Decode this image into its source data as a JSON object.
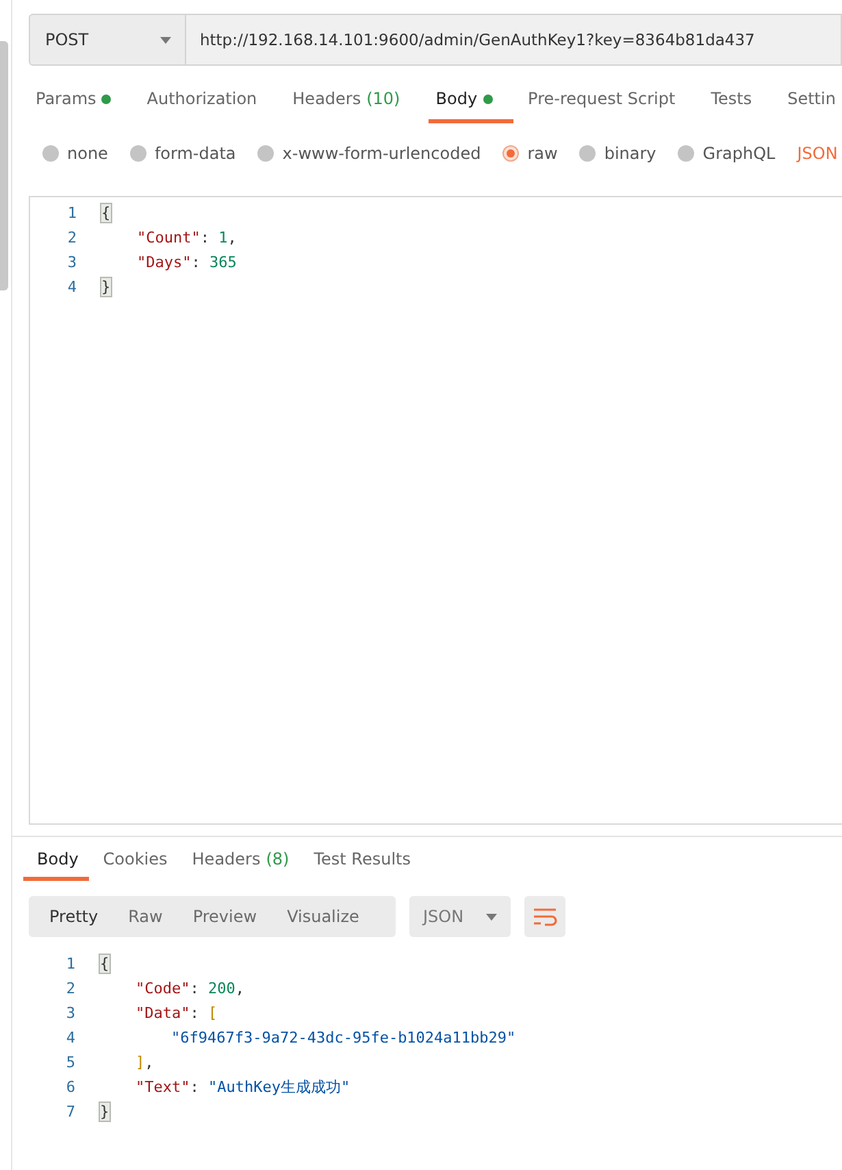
{
  "request": {
    "method": "POST",
    "url": "http://192.168.14.101:9600/admin/GenAuthKey1?key=8364b81da437"
  },
  "request_tabs": [
    {
      "label": "Params",
      "dot": true,
      "selected": false
    },
    {
      "label": "Authorization",
      "dot": false,
      "selected": false
    },
    {
      "label": "Headers",
      "count": "(10)",
      "dot": false,
      "selected": false
    },
    {
      "label": "Body",
      "dot": true,
      "selected": true
    },
    {
      "label": "Pre-request Script",
      "dot": false,
      "selected": false
    },
    {
      "label": "Tests",
      "dot": false,
      "selected": false
    },
    {
      "label": "Settin",
      "dot": false,
      "selected": false
    }
  ],
  "body_types": [
    {
      "label": "none",
      "selected": false
    },
    {
      "label": "form-data",
      "selected": false
    },
    {
      "label": "x-www-form-urlencoded",
      "selected": false
    },
    {
      "label": "raw",
      "selected": true
    },
    {
      "label": "binary",
      "selected": false
    },
    {
      "label": "GraphQL",
      "selected": false
    }
  ],
  "raw_format": "JSON",
  "request_body": [
    {
      "number": "1",
      "tokens": [
        {
          "kind": "brace",
          "text": "{"
        }
      ],
      "children": [
        {
          "number": "2",
          "tokens": [
            {
              "kind": "key",
              "text": "\"Count\""
            },
            {
              "kind": "punct",
              "text": ":"
            },
            {
              "kind": "number",
              "text": "1"
            },
            {
              "kind": "punct",
              "text": ","
            }
          ]
        },
        {
          "number": "3",
          "tokens": [
            {
              "kind": "key",
              "text": "\"Days\""
            },
            {
              "kind": "punct",
              "text": ":"
            },
            {
              "kind": "number",
              "text": "365"
            }
          ]
        }
      ]
    },
    {
      "number": "4",
      "tokens": [
        {
          "kind": "brace",
          "text": "}"
        }
      ]
    }
  ],
  "response_tabs": [
    {
      "label": "Body",
      "selected": true
    },
    {
      "label": "Cookies",
      "selected": false
    },
    {
      "label": "Headers",
      "count": "(8)",
      "selected": false
    },
    {
      "label": "Test Results",
      "selected": false
    }
  ],
  "view_modes": [
    {
      "label": "Pretty",
      "selected": true
    },
    {
      "label": "Raw",
      "selected": false
    },
    {
      "label": "Preview",
      "selected": false
    },
    {
      "label": "Visualize",
      "selected": false
    }
  ],
  "response_format": "JSON",
  "response_body": [
    {
      "number": "1",
      "tokens": [
        {
          "kind": "brace",
          "text": "{"
        }
      ],
      "children": [
        {
          "number": "2",
          "tokens": [
            {
              "kind": "key",
              "text": "\"Code\""
            },
            {
              "kind": "punct",
              "text": ":"
            },
            {
              "kind": "number",
              "text": "200"
            },
            {
              "kind": "punct",
              "text": ","
            }
          ]
        },
        {
          "number": "3",
          "tokens": [
            {
              "kind": "key",
              "text": "\"Data\""
            },
            {
              "kind": "punct",
              "text": ":"
            },
            {
              "kind": "bracket",
              "text": "["
            }
          ],
          "children": [
            {
              "number": "4",
              "tokens": [
                {
                  "kind": "string",
                  "text": "\"6f9467f3-9a72-43dc-95fe-b1024a11bb29\""
                }
              ]
            }
          ]
        },
        {
          "number": "5",
          "tokens": [
            {
              "kind": "bracket",
              "text": "]"
            },
            {
              "kind": "punct",
              "text": ","
            }
          ]
        },
        {
          "number": "6",
          "tokens": [
            {
              "kind": "key",
              "text": "\"Text\""
            },
            {
              "kind": "punct",
              "text": ":"
            },
            {
              "kind": "string",
              "text": "\"AuthKey生成成功\""
            }
          ]
        }
      ]
    },
    {
      "number": "7",
      "tokens": [
        {
          "kind": "brace",
          "text": "}"
        }
      ]
    }
  ]
}
